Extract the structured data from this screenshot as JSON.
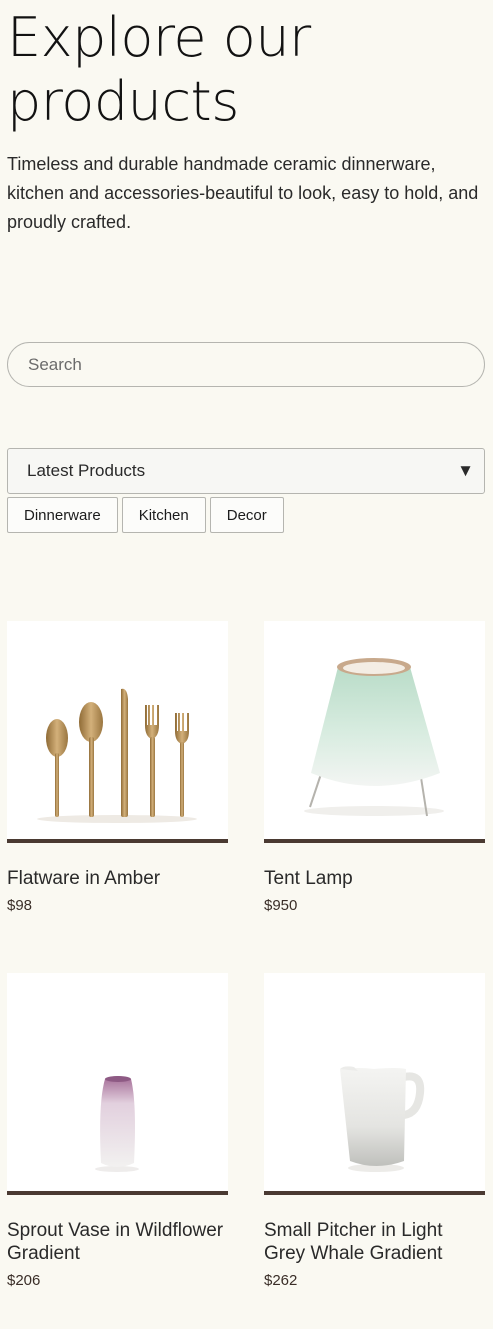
{
  "hero": {
    "title": "Explore our products",
    "subtitle": "Timeless and durable handmade ceramic dinnerware, kitchen and accessories-beautiful to look, easy to hold, and proudly crafted."
  },
  "search": {
    "placeholder": "Search"
  },
  "sort": {
    "selected": "Latest Products",
    "caret": "▼"
  },
  "filters": [
    "Dinnerware",
    "Kitchen",
    "Decor"
  ],
  "products": [
    {
      "name": "Flatware in Amber",
      "price": "$98",
      "image": "flatware"
    },
    {
      "name": "Tent Lamp",
      "price": "$950",
      "image": "lamp"
    },
    {
      "name": "Sprout Vase in Wildflower Gradient",
      "price": "$206",
      "image": "vase"
    },
    {
      "name": "Small Pitcher in Light Grey Whale Gradient",
      "price": "$262",
      "image": "pitcher"
    }
  ],
  "colors": {
    "background": "#faf9f2",
    "accent_bar": "#4a3a32",
    "amber": "#b8955a",
    "lamp_green": "#bfe0cf"
  }
}
